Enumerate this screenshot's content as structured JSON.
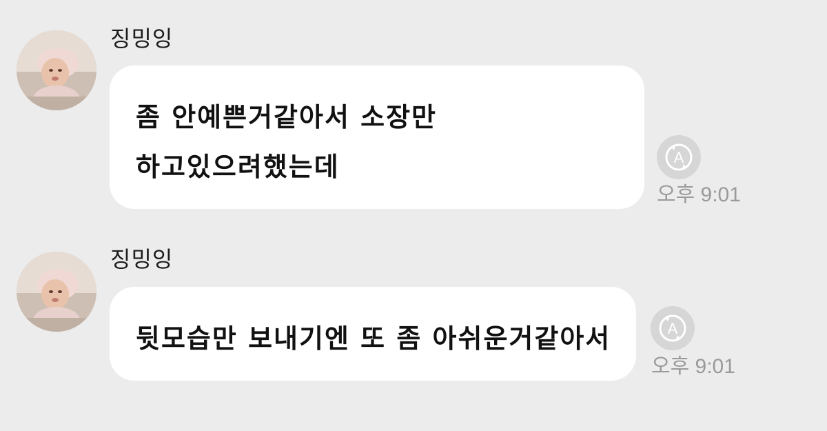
{
  "messages": [
    {
      "sender": "징밍잉",
      "lines": [
        "좀 안예쁜거같아서 소장만",
        "하고있으려했는데"
      ],
      "time": "오후 9:01"
    },
    {
      "sender": "징밍잉",
      "lines": [
        "뒷모습만 보내기엔 또 좀 아쉬운거같아서"
      ],
      "time": "오후 9:01"
    }
  ],
  "colors": {
    "background": "#ececec",
    "bubble": "#ffffff",
    "icon": "#d6d6d6",
    "time": "#9a9a9a"
  },
  "icons": {
    "avatar": "baby-photo-avatar",
    "read_status": "auto-translate-a-icon"
  }
}
